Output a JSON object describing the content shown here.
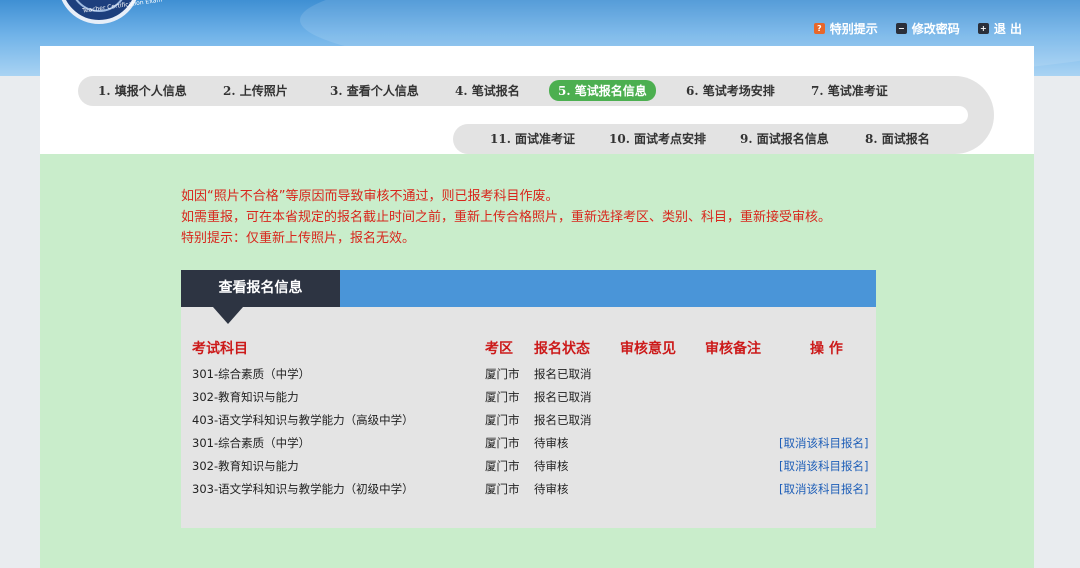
{
  "logo": {
    "text": "Teacher Certification Exam"
  },
  "toplinks": [
    {
      "label": "特别提示",
      "icon": "question-icon"
    },
    {
      "label": "修改密码",
      "icon": "minus-icon"
    },
    {
      "label": "退 出",
      "icon": "plus-icon"
    }
  ],
  "steps_row1": [
    "1. 填报个人信息",
    "2. 上传照片",
    "3. 查看个人信息",
    "4. 笔试报名",
    "5. 笔试报名信息",
    "6. 笔试考场安排",
    "7. 笔试准考证"
  ],
  "steps_row2": [
    "11. 面试准考证",
    "10. 面试考点安排",
    "9. 面试报名信息",
    "8. 面试报名"
  ],
  "active_step": "5. 笔试报名信息",
  "notice": [
    "如因“照片不合格”等原因而导致审核不通过，则已报考科目作废。",
    "如需重报，可在本省规定的报名截止时间之前，重新上传合格照片，重新选择考区、类别、科目，重新接受审核。",
    "特别提示：仅重新上传照片，报名无效。"
  ],
  "section_title": "查看报名信息",
  "table": {
    "headers": [
      "考试科目",
      "考区",
      "报名状态",
      "审核意见",
      "审核备注",
      "操 作"
    ],
    "rows": [
      [
        "301-综合素质（中学）",
        "厦门市",
        "报名已取消",
        "",
        "",
        ""
      ],
      [
        "302-教育知识与能力",
        "厦门市",
        "报名已取消",
        "",
        "",
        ""
      ],
      [
        "403-语文学科知识与教学能力（高级中学）",
        "厦门市",
        "报名已取消",
        "",
        "",
        ""
      ],
      [
        "301-综合素质（中学）",
        "厦门市",
        "待审核",
        "",
        "",
        "[取消该科目报名]"
      ],
      [
        "302-教育知识与能力",
        "厦门市",
        "待审核",
        "",
        "",
        "[取消该科目报名]"
      ],
      [
        "303-语文学科知识与教学能力（初级中学）",
        "厦门市",
        "待审核",
        "",
        "",
        "[取消该科目报名]"
      ]
    ]
  },
  "colors": {
    "active_step": "#4caf50",
    "notice_text": "#d8261c",
    "header_bar": "#4a95d8",
    "tab": "#2d3442",
    "content_bg": "#c9edcb"
  }
}
